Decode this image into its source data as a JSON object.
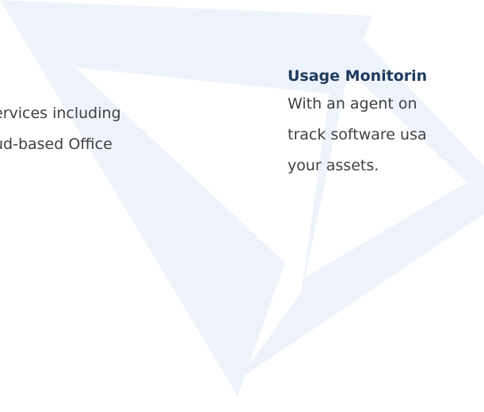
{
  "left_section": {
    "lines": [
      "ervices including",
      "ud-based Office"
    ]
  },
  "right_section": {
    "heading": "Usage Monitorin",
    "lines": [
      "With an agent on",
      "track software usa",
      "your assets."
    ]
  },
  "colors": {
    "background": "#ffffff",
    "body_text": "#3f3f3f",
    "heading_text": "#1f3b5e",
    "watermark": "#eef3fb"
  },
  "watermark": {
    "icon": "triangle-logo-watermark"
  }
}
